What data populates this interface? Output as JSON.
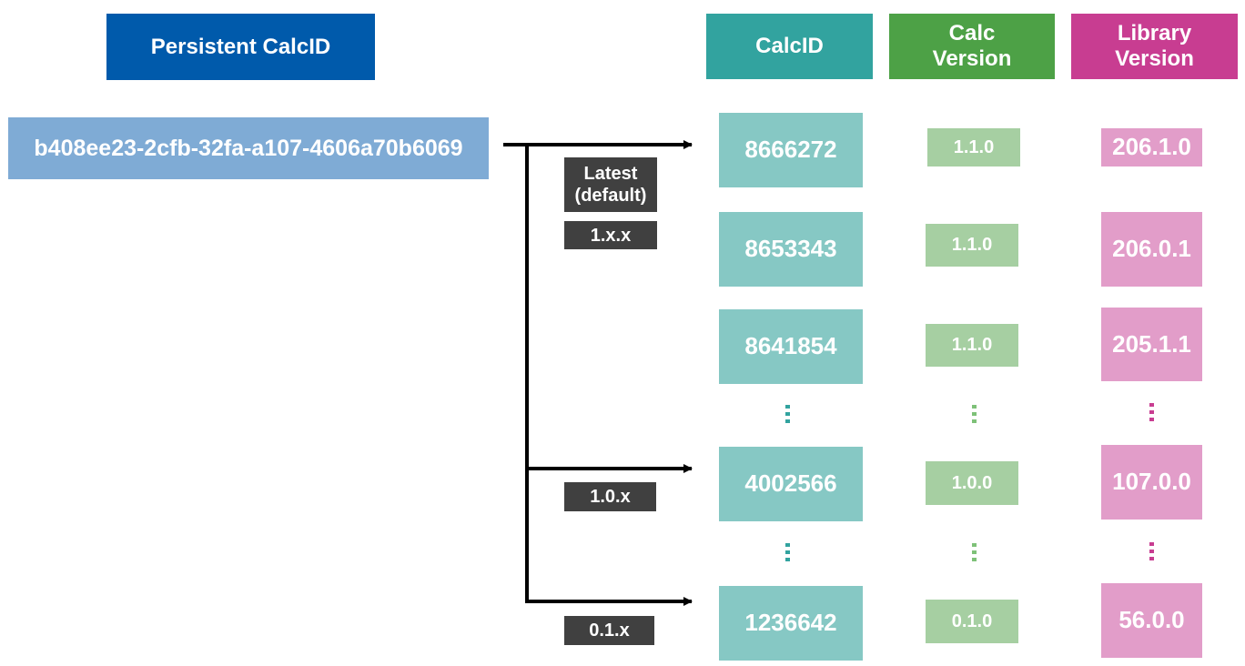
{
  "headers": {
    "persistent_calcid": "Persistent CalcID",
    "calcid": "CalcID",
    "calc_version": "Calc Version",
    "library_version": "Library Version"
  },
  "persistent_id": "b408ee23-2cfb-32fa-a107-4606a70b6069",
  "branch_tags": {
    "latest": "Latest (default)",
    "v1xx": "1.x.x",
    "v10x": "1.0.x",
    "v01x": "0.1.x"
  },
  "rows": [
    {
      "calcid": "8666272",
      "calc_version": "1.1.0",
      "library_version": "206.1.0"
    },
    {
      "calcid": "8653343",
      "calc_version": "1.1.0",
      "library_version": "206.0.1"
    },
    {
      "calcid": "8641854",
      "calc_version": "1.1.0",
      "library_version": "205.1.1"
    },
    {
      "calcid": "4002566",
      "calc_version": "1.0.0",
      "library_version": "107.0.0"
    },
    {
      "calcid": "1236642",
      "calc_version": "0.1.0",
      "library_version": "56.0.0"
    }
  ],
  "colors": {
    "persistent_header": "#005aab",
    "persistent_value": "#7fabd5",
    "calcid_header": "#32a39f",
    "calcid_value": "#86c8c4",
    "calcver_header": "#4da146",
    "calcver_value": "#a6cfa2",
    "libver_header": "#c83d91",
    "libver_value": "#e29dc9",
    "tag_bg": "#404040"
  }
}
